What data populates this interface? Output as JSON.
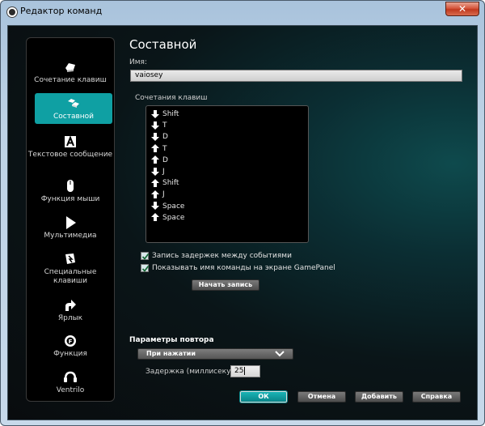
{
  "window": {
    "title": "Редактор команд",
    "close_glyph": "✕"
  },
  "sidebar": {
    "items": [
      {
        "label": "Сочетание клавиш",
        "icon": "keyboard-key-icon"
      },
      {
        "label": "Составной",
        "icon": "multikey-icon",
        "active": true
      },
      {
        "label": "Текстовое сообщение",
        "icon": "text-a-icon"
      },
      {
        "label": "Функция мыши",
        "icon": "mouse-icon"
      },
      {
        "label": "Мультимедиа",
        "icon": "play-icon"
      },
      {
        "label": "Специальные клавиши",
        "icon": "special-key-icon"
      },
      {
        "label": "Ярлык",
        "icon": "shortcut-arrow-icon"
      },
      {
        "label": "Функция",
        "icon": "function-gear-icon"
      },
      {
        "label": "Ventrilo",
        "icon": "headset-icon"
      }
    ]
  },
  "main": {
    "title": "Составной",
    "name_label": "Имя:",
    "name_value": "vaiosey",
    "sequence_label": "Сочетания клавиш",
    "sequence": [
      {
        "dir": "down",
        "key": "Shift"
      },
      {
        "dir": "down",
        "key": "T"
      },
      {
        "dir": "down",
        "key": "D"
      },
      {
        "dir": "up",
        "key": "T"
      },
      {
        "dir": "up",
        "key": "D"
      },
      {
        "dir": "down",
        "key": "J"
      },
      {
        "dir": "up",
        "key": "Shift"
      },
      {
        "dir": "up",
        "key": "J"
      },
      {
        "dir": "down",
        "key": "Space"
      },
      {
        "dir": "up",
        "key": "Space"
      }
    ],
    "record_delays_label": "Запись задержек между событиями",
    "record_delays_checked": true,
    "show_name_label": "Показывать имя команды на экране GamePanel",
    "show_name_checked": true,
    "start_record_label": "Начать запись",
    "repeat_label": "Параметры повтора",
    "repeat_option": "При нажатии",
    "delay_label": "Задержка (миллисекунд):",
    "delay_value": "25"
  },
  "footer": {
    "ok_label": "ОК",
    "cancel_label": "Отмена",
    "add_label": "Добавить",
    "help_label": "Справка"
  },
  "colors": {
    "accent": "#0fa0a3",
    "background": "#0a1518",
    "sidebar": "#000000"
  }
}
